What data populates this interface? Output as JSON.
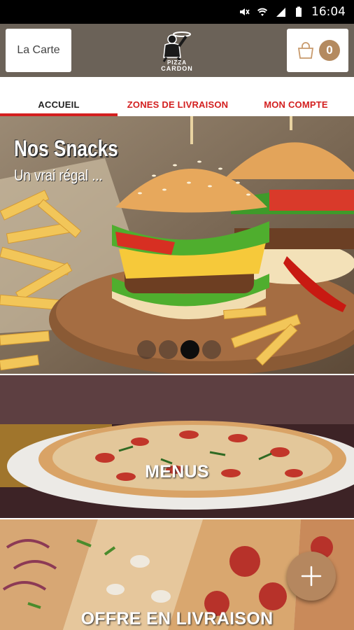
{
  "status_bar": {
    "time": "16:04"
  },
  "header": {
    "menu_button_label": "La Carte",
    "logo_text": "PIZZA CARDON",
    "cart_count": "0"
  },
  "tabs": [
    {
      "label": "ACCUEIL",
      "active": true
    },
    {
      "label": "ZONES DE LIVRAISON",
      "active": false
    },
    {
      "label": "MON COMPTE",
      "active": false
    }
  ],
  "slider": {
    "title": "Nos Snacks",
    "subtitle": "Un vrai régal ...",
    "slide_count": 4,
    "active_index": 2
  },
  "banners": [
    {
      "label": "MENUS"
    },
    {
      "label": "OFFRE EN LIVRAISON"
    }
  ],
  "colors": {
    "accent": "#d31f1f",
    "brand": "#6b6258",
    "badge": "#b48a5f",
    "fab": "#b5875f"
  }
}
